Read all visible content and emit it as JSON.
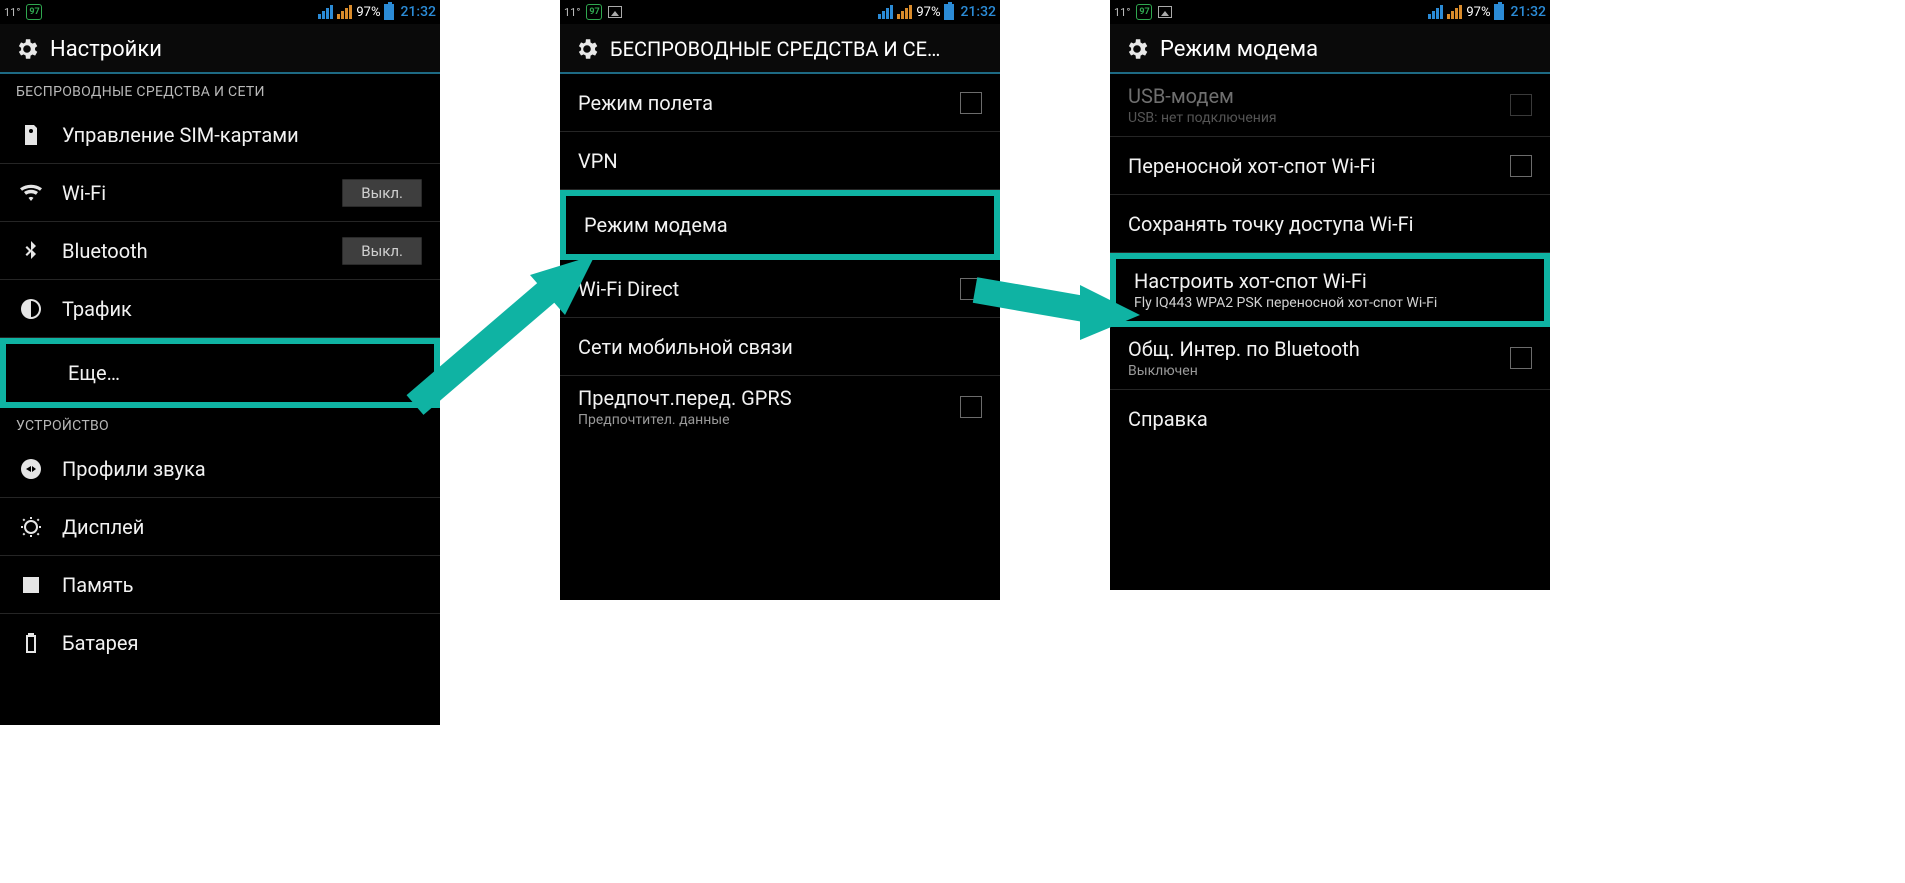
{
  "status": {
    "temp": "11°",
    "badge": "97",
    "percent": "97%",
    "clock": "21:32"
  },
  "screen1": {
    "title": "Настройки",
    "section_wireless": "БЕСПРОВОДНЫЕ СРЕДСТВА И СЕТИ",
    "sim": "Управление SIM-картами",
    "wifi": "Wi-Fi",
    "wifi_state": "Выкл.",
    "bt": "Bluetooth",
    "bt_state": "Выкл.",
    "traffic": "Трафик",
    "more": "Еще…",
    "section_device": "УСТРОЙСТВО",
    "sound": "Профили звука",
    "display": "Дисплей",
    "memory": "Память",
    "battery": "Батарея"
  },
  "screen2": {
    "title": "БЕСПРОВОДНЫЕ СРЕДСТВА И СЕ…",
    "airplane": "Режим полета",
    "vpn": "VPN",
    "tether": "Режим модема",
    "wifidir": "Wi-Fi Direct",
    "mobile": "Сети мобильной связи",
    "gprs": "Предпочт.перед. GPRS",
    "gprs_sub": "Предпочтител. данные"
  },
  "screen3": {
    "title": "Режим модема",
    "usb": "USB-модем",
    "usb_sub": "USB: нет подключения",
    "hotspot": "Переносной хот-спот Wi-Fi",
    "save": "Сохранять точку доступа Wi-Fi",
    "configure": "Настроить хот-спот Wi-Fi",
    "configure_sub": "Fly IQ443 WPA2 PSK переносной хот-спот Wi-Fi",
    "btnet": "Общ. Интер. по Bluetooth",
    "btnet_sub": "Выключен",
    "help": "Справка"
  }
}
